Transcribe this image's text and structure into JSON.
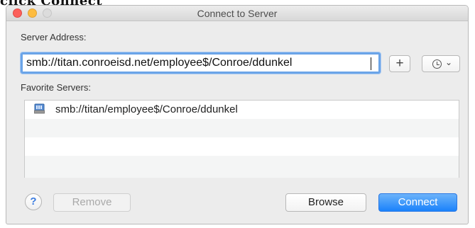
{
  "background_text": "click Connect",
  "window": {
    "title": "Connect to Server",
    "traffic_colors": {
      "close": "#fc605b",
      "minimize": "#fdbc40",
      "zoom": "#dcdcdc"
    }
  },
  "server_address": {
    "label": "Server Address:",
    "value": "smb://titan.conroeisd.net/employee$/Conroe/ddunkel"
  },
  "address_buttons": {
    "add": {
      "glyph": "+",
      "icon": "plus-icon"
    },
    "recent": {
      "icon": "clock-icon",
      "chevron": "⌄"
    }
  },
  "favorites": {
    "label": "Favorite Servers:",
    "items": [
      {
        "icon": "network-server-icon",
        "text": "smb://titan/employee$/Conroe/ddunkel"
      }
    ]
  },
  "footer": {
    "help_label": "?",
    "remove_label": "Remove",
    "browse_label": "Browse",
    "connect_label": "Connect"
  },
  "colors": {
    "accent": "#1a82fb",
    "focus_ring": "#6ba4e8",
    "window_bg": "#ececec"
  }
}
